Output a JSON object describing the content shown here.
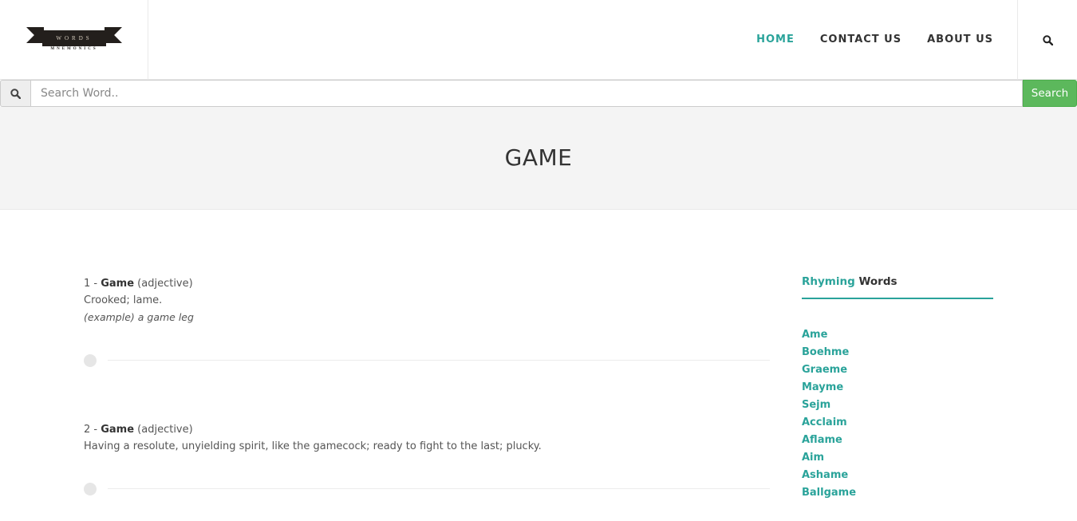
{
  "logo": {
    "banner_text": "WORDS",
    "subtitle": "MNEMONICS"
  },
  "nav": {
    "items": [
      {
        "label": "HOME"
      },
      {
        "label": "CONTACT US"
      },
      {
        "label": "ABOUT US"
      }
    ]
  },
  "search": {
    "placeholder": "Search Word..",
    "button_label": "Search"
  },
  "page_title": "GAME",
  "definitions": [
    {
      "index": "1 - ",
      "word": "Game",
      "pos": " (adjective)",
      "text": "Crooked; lame.",
      "example": "(example) a game leg"
    },
    {
      "index": "2 - ",
      "word": "Game",
      "pos": " (adjective)",
      "text": "Having a resolute, unyielding spirit, like the gamecock; ready to fight to the last; plucky."
    }
  ],
  "sidebar": {
    "title_accent": "Rhyming",
    "title_rest": " Words",
    "rhymes": [
      "Ame",
      "Boehme",
      "Graeme",
      "Mayme",
      "Sejm",
      "Acclaim",
      "Aflame",
      "Aim",
      "Ashame",
      "Ballgame"
    ]
  },
  "colors": {
    "accent": "#2aa39a",
    "search_button": "#5cb85c"
  }
}
